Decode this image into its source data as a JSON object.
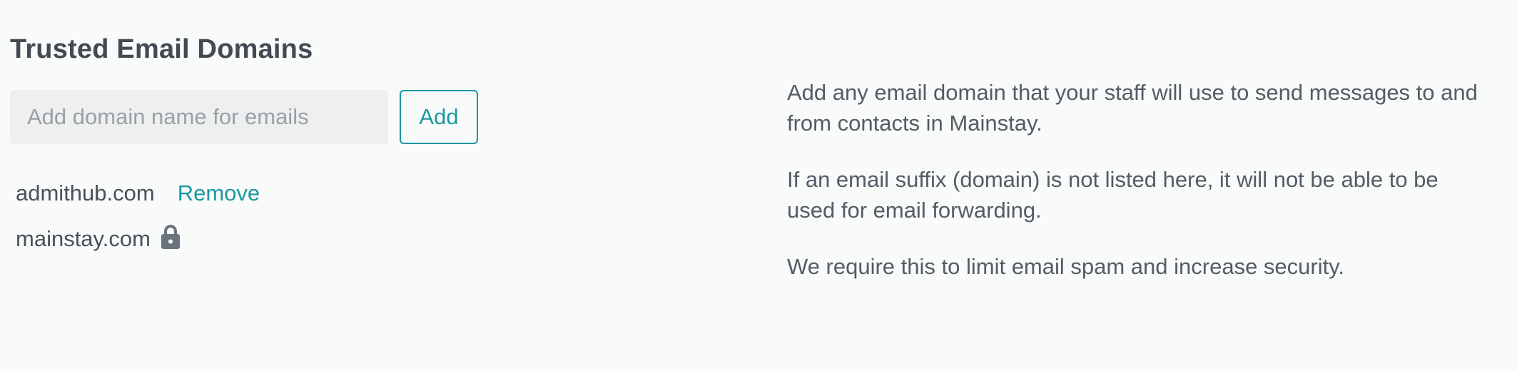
{
  "section": {
    "title": "Trusted Email Domains"
  },
  "add_form": {
    "input_placeholder": "Add domain name for emails",
    "input_value": "",
    "add_label": "Add"
  },
  "domains": [
    {
      "name": "admithub.com",
      "action_label": "Remove",
      "locked": false
    },
    {
      "name": "mainstay.com",
      "action_label": "",
      "locked": true,
      "icon": "lock-icon"
    }
  ],
  "help": {
    "paragraphs": [
      "Add any email domain that your staff will use to send messages to and from contacts in Mainstay.",
      "If an email suffix (domain) is not listed here, it will not be able to be used for email forwarding.",
      "We require this to limit email spam and increase security."
    ]
  },
  "colors": {
    "accent": "#1a98a2",
    "text": "#4a5159",
    "input_bg": "#eeefef",
    "page_bg": "#f9fafa"
  }
}
